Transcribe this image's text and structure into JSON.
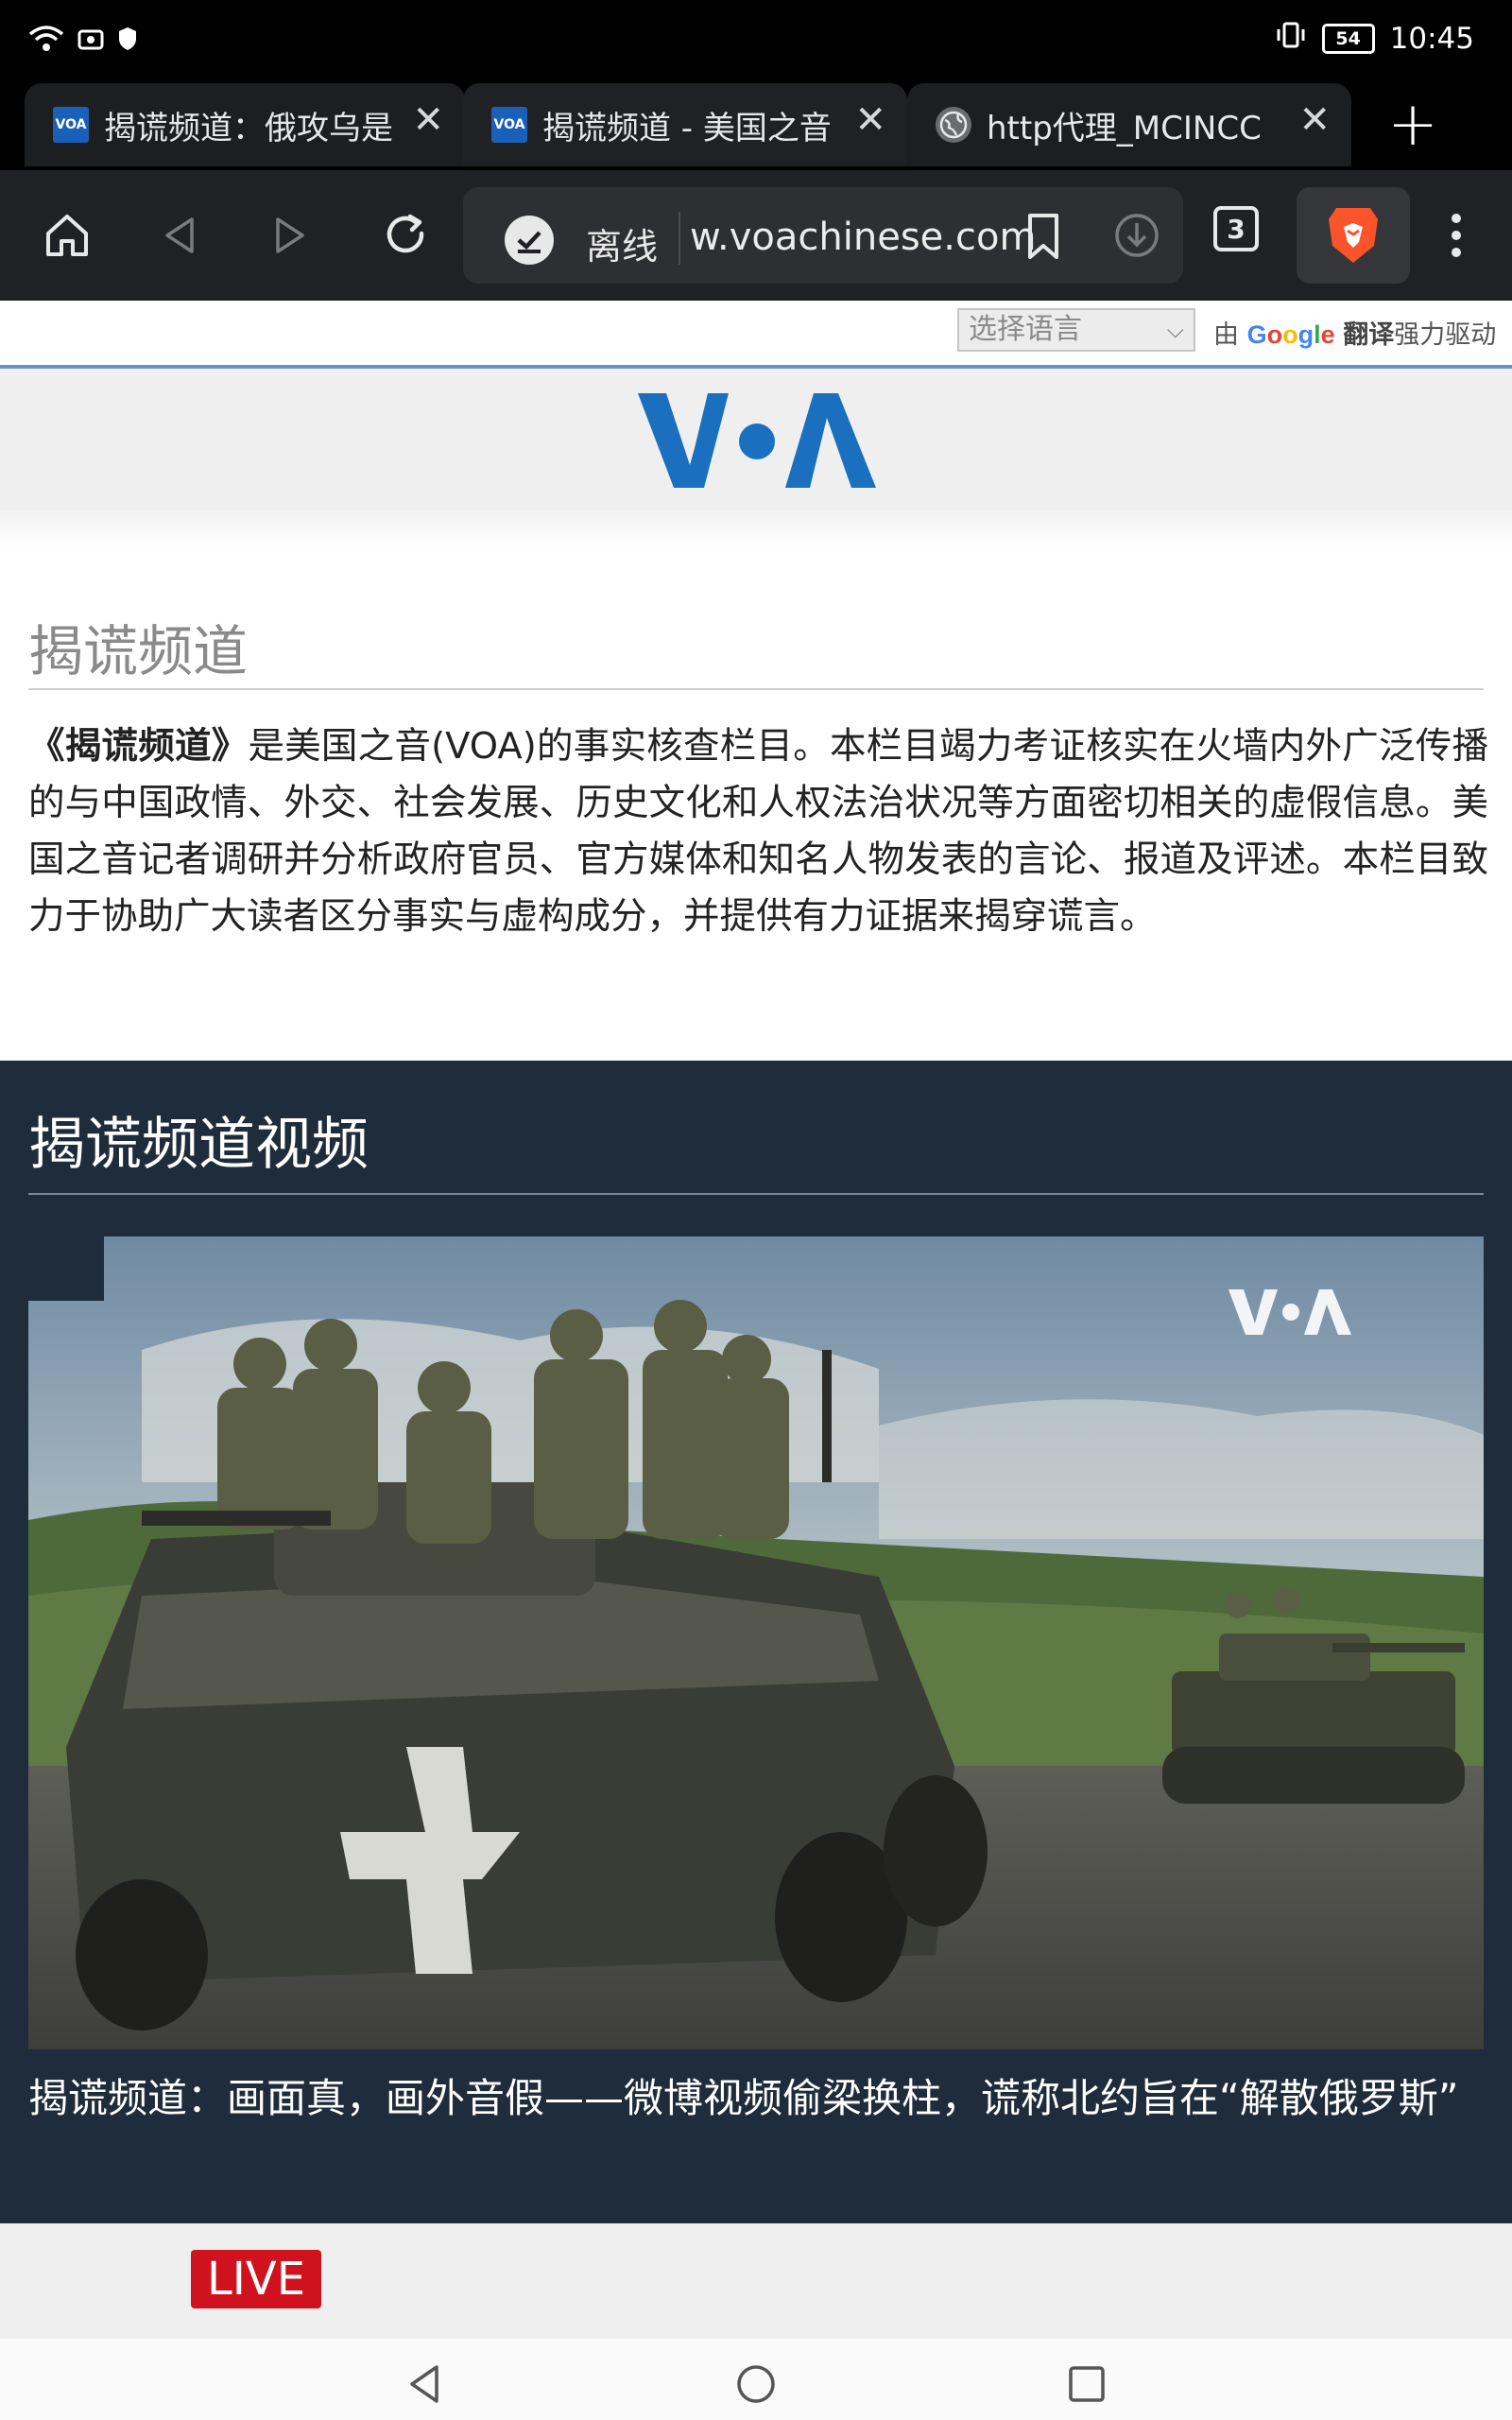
{
  "status_bar": {
    "time": "10:45",
    "battery": "54",
    "icons": [
      "wifi-icon",
      "screen-record-icon",
      "shield-icon",
      "vibrate-icon",
      "battery-icon"
    ]
  },
  "tabs": [
    {
      "favicon": "VOA",
      "title": "揭谎频道：俄攻乌是",
      "active": false
    },
    {
      "favicon": "VOA",
      "title": "揭谎频道 - 美国之音",
      "active": true
    },
    {
      "favicon": "globe",
      "title": "http代理_MCINCC",
      "active": false
    }
  ],
  "toolbar": {
    "offline_label": "离线",
    "url": "w.voachinese.com",
    "tab_count": "3",
    "icons": [
      "home-icon",
      "back-icon",
      "forward-icon",
      "reload-icon",
      "offline-status-icon",
      "bookmark-icon",
      "download-icon",
      "tab-count-icon",
      "brave-shield-icon",
      "menu-icon"
    ]
  },
  "translate": {
    "select_placeholder": "选择语言",
    "powered_prefix": "由",
    "brand_letters": [
      "G",
      "o",
      "o",
      "g",
      "l",
      "e"
    ],
    "translate_word": "翻译",
    "powered_suffix": "强力驱动"
  },
  "brand": {
    "logo": "VOA",
    "accent": "#1a6fbf"
  },
  "intro": {
    "title": "揭谎频道",
    "bold_name": "《揭谎频道》",
    "text": "是美国之音(VOA)的事实核查栏目。本栏目竭力考证核实在火墙内外广泛传播的与中国政情、外交、社会发展、历史文化和人权法治状况等方面密切相关的虚假信息。美国之音记者调研并分析政府官员、官方媒体和知名人物发表的言论、报道及评述。本栏目致力于协助广大读者区分事实与虚构成分，并提供有力证据来揭穿谎言。"
  },
  "videos": {
    "section_title": "揭谎频道视频",
    "items": [
      {
        "caption": "揭谎频道：画面真，画外音假——微博视频偷梁换柱，谎称北约旨在“解散俄罗斯”",
        "watermark": "VOA"
      }
    ]
  },
  "live": {
    "label": "LIVE",
    "color": "#d0121f"
  },
  "nav": {
    "icons": [
      "nav-back-icon",
      "nav-home-icon",
      "nav-recents-icon"
    ]
  }
}
